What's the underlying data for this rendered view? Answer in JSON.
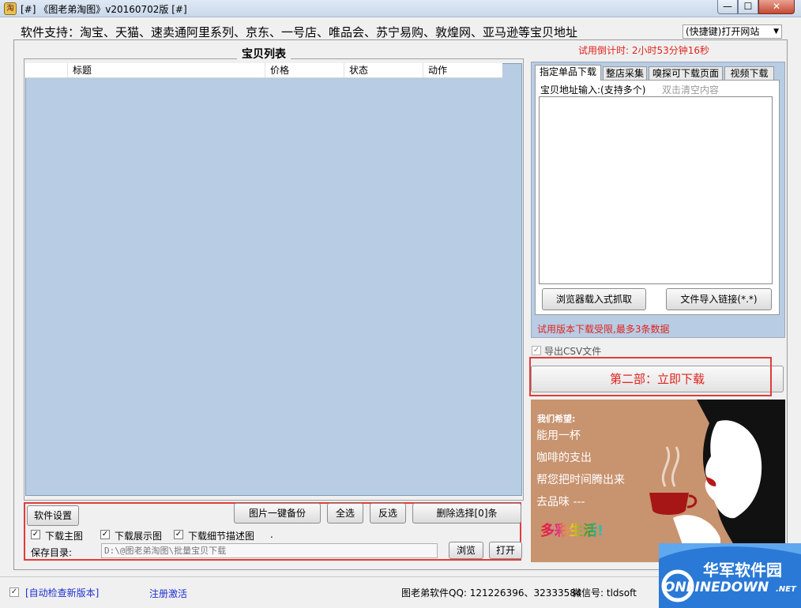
{
  "window": {
    "title": "[#] 《图老弟淘图》v20160702版 [#]",
    "icon": "app-icon",
    "min_symbol": "—",
    "max_symbol": "☐",
    "close_symbol": "✕"
  },
  "header": {
    "support_text": "软件支持：淘宝、天猫、速卖通阿里系列、京东、一号店、唯品会、苏宁易购、敦煌网、亚马逊等宝贝地址",
    "quick_select_value": "(快捷键)打开网站"
  },
  "list": {
    "title": "宝贝列表",
    "columns": [
      "",
      "标题",
      "价格",
      "状态",
      "动作"
    ]
  },
  "controls": {
    "settings_label": "软件设置",
    "backup_label": "图片一键备份",
    "select_all_label": "全选",
    "invert_label": "反选",
    "delete_label": "删除选择[0]条",
    "download_main_label": "下载主图",
    "download_display_label": "下载展示图",
    "download_detail_label": "下载细节描述图",
    "dot": ".",
    "save_dir_label": "保存目录:",
    "save_dir_value": "D:\\@图老弟淘图\\批量宝贝下载",
    "browse_label": "浏览",
    "open_label": "打开",
    "checkbox_mark": "✓"
  },
  "right": {
    "trial_countdown": "试用倒计时: 2小时53分钟16秒",
    "tabs": [
      "指定单品下载",
      "整店采集",
      "嗅探可下载页面",
      "视频下载"
    ],
    "url_label": "宝贝地址输入:(支持多个)",
    "url_hint": "双击清空内容",
    "browser_grab_label": "浏览器载入式抓取",
    "file_import_label": "文件导入链接(*.*)",
    "limit_text": "试用版本下载受限,最多3条数据",
    "export_csv_label": "导出CSV文件",
    "download_now_label": "第二部：立即下载"
  },
  "ad": {
    "hope": "我们希望:",
    "lines": [
      "能用一杯",
      "咖啡的支出",
      "帮您把时间腾出来",
      "去品味 ---"
    ],
    "colorful": "多彩生活!"
  },
  "status": {
    "auto_check": "[自动检查新版本]",
    "register": "注册激活",
    "qq_info": "图老弟软件QQ: 121226396、32333584",
    "wechat_info": "微信号: tldsoft"
  },
  "watermark": {
    "cn": "华军软件园",
    "en": "ONLINEDOWN",
    "net": ".NET"
  },
  "colors": {
    "list_bg": "#b8cce4",
    "accent_red": "#e0241d",
    "link_blue": "#1c2fd0"
  }
}
